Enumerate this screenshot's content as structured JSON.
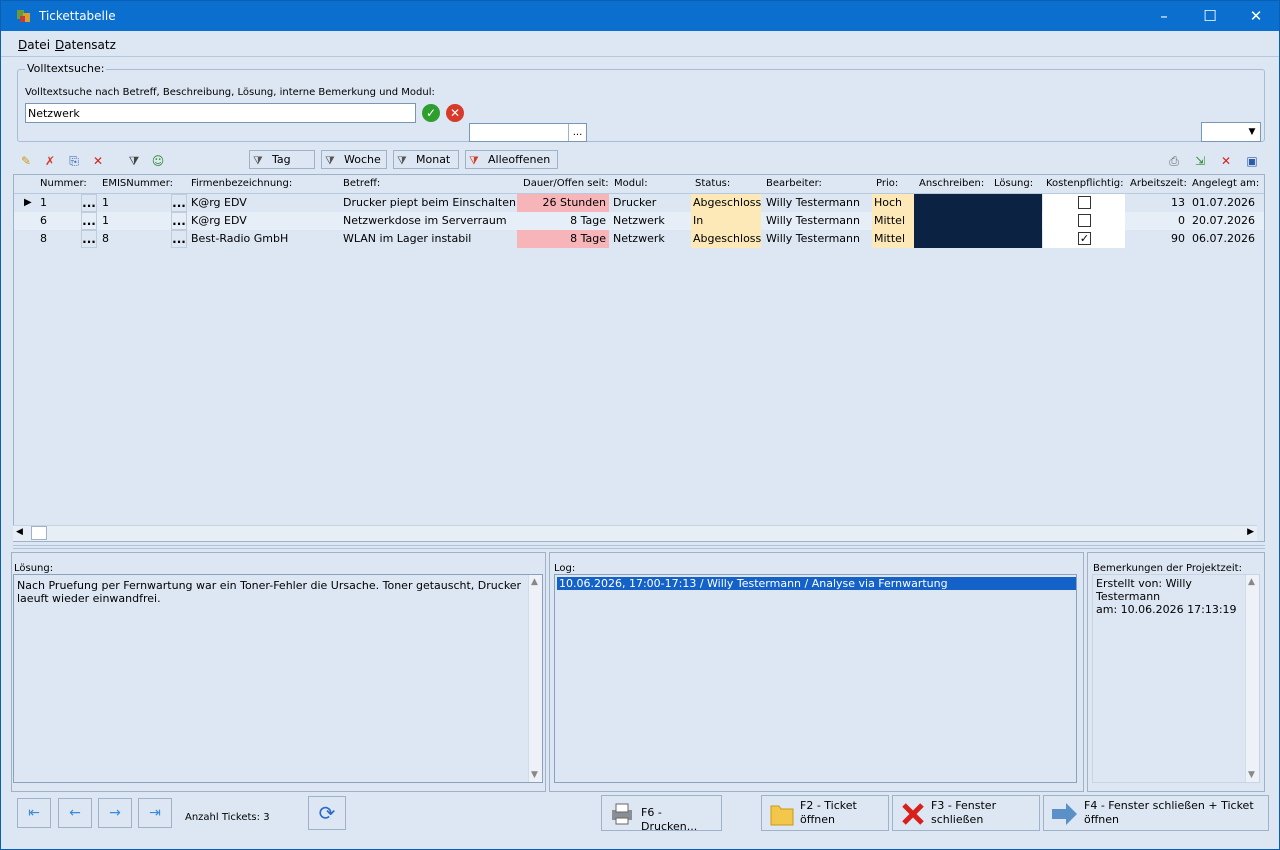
{
  "window": {
    "title": "Tickettabelle"
  },
  "menu": [
    {
      "label": "Datei"
    },
    {
      "label": "Datensatz"
    }
  ],
  "search": {
    "group_label": "Volltextsuche:",
    "hint": "Volltextsuche nach Betreff, Beschreibung, Lösung, interne Bemerkung und Modul:",
    "value": "Netzwerk",
    "picker_button": "...",
    "accent_ok": "#2e9e2e",
    "accent_cancel": "#d83a2a"
  },
  "toolbar": {
    "icons": [
      "edit-filter-icon",
      "clear-filter-icon",
      "copy-icon",
      "delete-icon",
      "filter-icon",
      "user-filter-icon"
    ],
    "filter_buttons": [
      {
        "label": "Tag"
      },
      {
        "label": "Woche"
      },
      {
        "label": "Monat"
      },
      {
        "label": "Alleoffenen"
      }
    ],
    "right_icons": [
      "print-icon",
      "export-icon",
      "delete-record-icon",
      "save-icon"
    ]
  },
  "grid": {
    "columns": [
      "Nummer:",
      "EMISNummer:",
      "Firmenbezeichnung:",
      "Betreff:",
      "Dauer/Offen seit:",
      "Modul:",
      "Status:",
      "Bearbeiter:",
      "Prio:",
      "Anschreiben:",
      "Lösung:",
      "Kostenpflichtig:",
      "Arbeitszeit:",
      "Angelegt am:"
    ],
    "rows": [
      {
        "nummer": "1",
        "emis": "1",
        "firma": "K@rg EDV",
        "betreff": "Drucker piept beim Einschalten",
        "dauer": "26 Stunden",
        "modul": "Drucker",
        "status": "Abgeschloss",
        "bearbeiter": "Willy Testermann",
        "prio": "Hoch",
        "kostenpflichtig": false,
        "arbeitszeit": "13",
        "angelegt": "01.07.2026",
        "dauer_highlight": true
      },
      {
        "nummer": "6",
        "emis": "1",
        "firma": "K@rg EDV",
        "betreff": "Netzwerkdose im Serverraum",
        "dauer": "8 Tage",
        "modul": "Netzwerk",
        "status": "In",
        "bearbeiter": "Willy Testermann",
        "prio": "Mittel",
        "kostenpflichtig": false,
        "arbeitszeit": "0",
        "angelegt": "20.07.2026",
        "dauer_highlight": false
      },
      {
        "nummer": "8",
        "emis": "8",
        "firma": "Best-Radio GmbH",
        "betreff": "WLAN im Lager instabil",
        "dauer": "8 Tage",
        "modul": "Netzwerk",
        "status": "Abgeschloss",
        "bearbeiter": "Willy Testermann",
        "prio": "Mittel",
        "kostenpflichtig": true,
        "arbeitszeit": "90",
        "angelegt": "06.07.2026",
        "dauer_highlight": true
      }
    ],
    "dots_label": "...",
    "colors": {
      "highlight_pink": "#f7b5b9",
      "status_yellow": "#fde9b8",
      "dark_cell": "#0b2243"
    }
  },
  "panels": {
    "loesung": {
      "label": "Lösung:",
      "text": "Nach Pruefung per Fernwartung war ein Toner-Fehler die Ursache. Toner getauscht, Drucker laeuft wieder einwandfrei."
    },
    "log": {
      "label": "Log:",
      "entry": "10.06.2026, 17:00-17:13 / Willy Testermann / Analyse via Fernwartung"
    },
    "bemerkungen": {
      "label": "Bemerkungen der Projektzeit:",
      "line1": "Erstellt von: Willy Testermann",
      "line2": "am: 10.06.2026 17:13:19"
    }
  },
  "footer": {
    "count_label": "Anzahl Tickets: 3",
    "print_label": "F6 - Drucken...",
    "open_line1": "F2 - Ticket",
    "open_line2": "öffnen",
    "close_line1": "F3 - Fenster",
    "close_line2": "schließen",
    "closeopen_line1": "F4 - Fenster schließen + Ticket",
    "closeopen_line2": "öffnen"
  }
}
